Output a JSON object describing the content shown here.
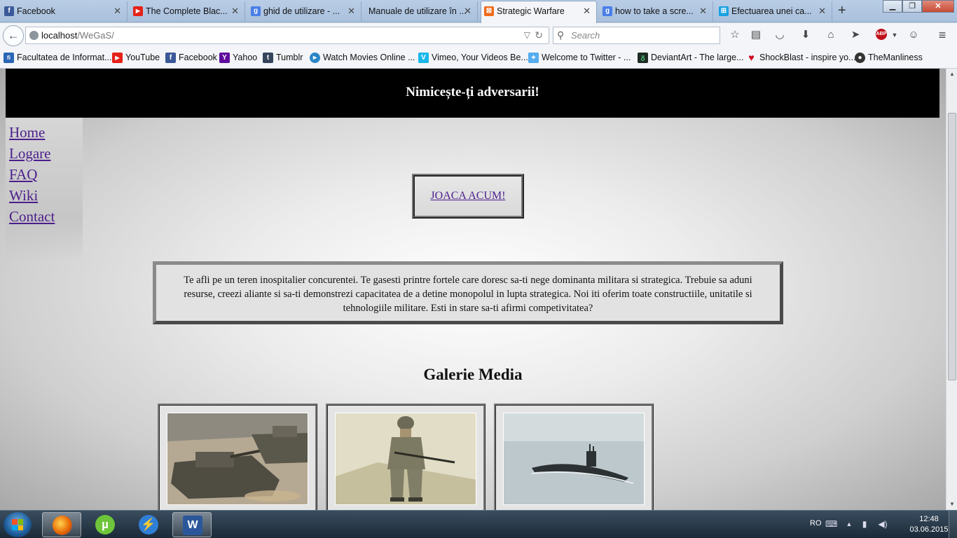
{
  "browser": {
    "tabs": [
      {
        "label": "Facebook",
        "icon": "facebook-icon",
        "color": "#3b5998",
        "glyph": "f"
      },
      {
        "label": "The Complete Blac...",
        "icon": "youtube-icon",
        "color": "#e62117",
        "glyph": "▶"
      },
      {
        "label": "ghid de utilizare - ...",
        "icon": "google-icon",
        "color": "#4a7ee8",
        "glyph": "g"
      },
      {
        "label": "Manuale de utilizare în ...",
        "icon": "blank-page-icon",
        "color": "",
        "glyph": ""
      },
      {
        "label": "Strategic Warfare",
        "icon": "xampp-icon",
        "color": "#f06a1a",
        "glyph": "⊠"
      },
      {
        "label": "how to take a scre...",
        "icon": "google-icon",
        "color": "#4a7ee8",
        "glyph": "g"
      },
      {
        "label": "Efectuarea unei ca...",
        "icon": "windows-icon",
        "color": "#1aa1e1",
        "glyph": "⊞"
      }
    ],
    "address": {
      "host": "localhost",
      "path": "/WeGaS/"
    },
    "search_placeholder": "Search",
    "bookmarks": [
      {
        "label": "Facultatea de Informat...",
        "icon": "fii-icon",
        "color": "#2a66b5",
        "glyph": "fi"
      },
      {
        "label": "YouTube",
        "icon": "youtube-icon",
        "color": "#e62117",
        "glyph": "▶"
      },
      {
        "label": "Facebook",
        "icon": "facebook-icon",
        "color": "#3b5998",
        "glyph": "f"
      },
      {
        "label": "Yahoo",
        "icon": "yahoo-icon",
        "color": "#5f0c9e",
        "glyph": "Y"
      },
      {
        "label": "Tumblr",
        "icon": "tumblr-icon",
        "color": "#35465c",
        "glyph": "t"
      },
      {
        "label": "Watch Movies Online ...",
        "icon": "play-circle-icon",
        "color": "#2b86c7",
        "glyph": "▸"
      },
      {
        "label": "Vimeo, Your Videos Be...",
        "icon": "vimeo-icon",
        "color": "#1ab7ea",
        "glyph": "V"
      },
      {
        "label": "Welcome to Twitter - ...",
        "icon": "twitter-icon",
        "color": "#55acee",
        "glyph": "🐦"
      },
      {
        "label": "DeviantArt - The large...",
        "icon": "deviantart-icon",
        "color": "#1f2b24",
        "glyph": "ᵹ"
      },
      {
        "label": "ShockBlast - inspire yo...",
        "icon": "heart-icon",
        "color": "#d0021b",
        "glyph": "♥"
      },
      {
        "label": "TheManliness",
        "icon": "manliness-icon",
        "color": "#333333",
        "glyph": "●"
      }
    ]
  },
  "site": {
    "tagline": "Nimicește-ți adversarii!",
    "nav": [
      "Home",
      "Logare",
      "FAQ",
      "Wiki",
      "Contact"
    ],
    "play_label": "JOACA ACUM!",
    "intro": "Te afli pe un teren inospitalier concurentei. Te gasesti printre fortele care doresc sa-ti nege dominanta militara si strategica. Trebuie sa aduni resurse, creezi aliante si sa-ti demonstrezi capacitatea de a detine monopolul in lupta strategica. Noi iti oferim toate constructiile, unitatile si tehnologiile militare. Esti in stare sa-ti afirmi competivitatea?",
    "gallery_title": "Galerie Media",
    "gallery": [
      {
        "subject": "tanks-image"
      },
      {
        "subject": "soldier-image"
      },
      {
        "subject": "submarine-image"
      }
    ]
  },
  "taskbar": {
    "language": "RO",
    "time": "12:48",
    "date": "03.06.2015"
  },
  "colors": {
    "link_visited": "#4b1e8c",
    "header_bg": "#000000"
  }
}
